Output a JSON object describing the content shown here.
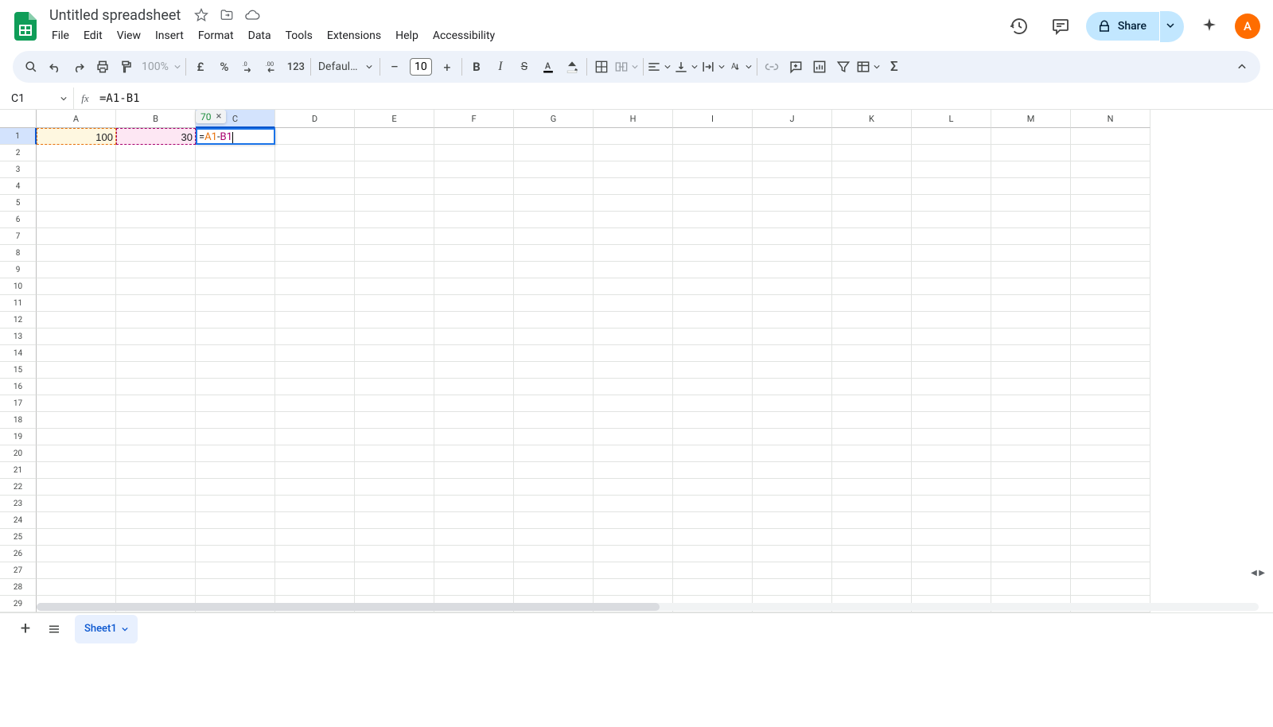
{
  "doc": {
    "title": "Untitled spreadsheet"
  },
  "menu": [
    "File",
    "Edit",
    "View",
    "Insert",
    "Format",
    "Data",
    "Tools",
    "Extensions",
    "Help",
    "Accessibility"
  ],
  "share": {
    "label": "Share"
  },
  "avatar": {
    "initial": "A"
  },
  "toolbar": {
    "zoom": "100%",
    "currency_symbol": "£",
    "number_format": "123",
    "font": "Defaul…",
    "font_size": "10"
  },
  "name_box": "C1",
  "formula": "=A1-B1",
  "formula_tokens": {
    "eq": "=",
    "ref_a": "A1",
    "minus": "-",
    "ref_b": "B1"
  },
  "preview_result": "70",
  "columns": [
    "A",
    "B",
    "C",
    "D",
    "E",
    "F",
    "G",
    "H",
    "I",
    "J",
    "K",
    "L",
    "M",
    "N"
  ],
  "active_col": "C",
  "active_row": 1,
  "rows": 30,
  "cells": {
    "A1": "100",
    "B1": "30"
  },
  "sheet_tab": "Sheet1"
}
